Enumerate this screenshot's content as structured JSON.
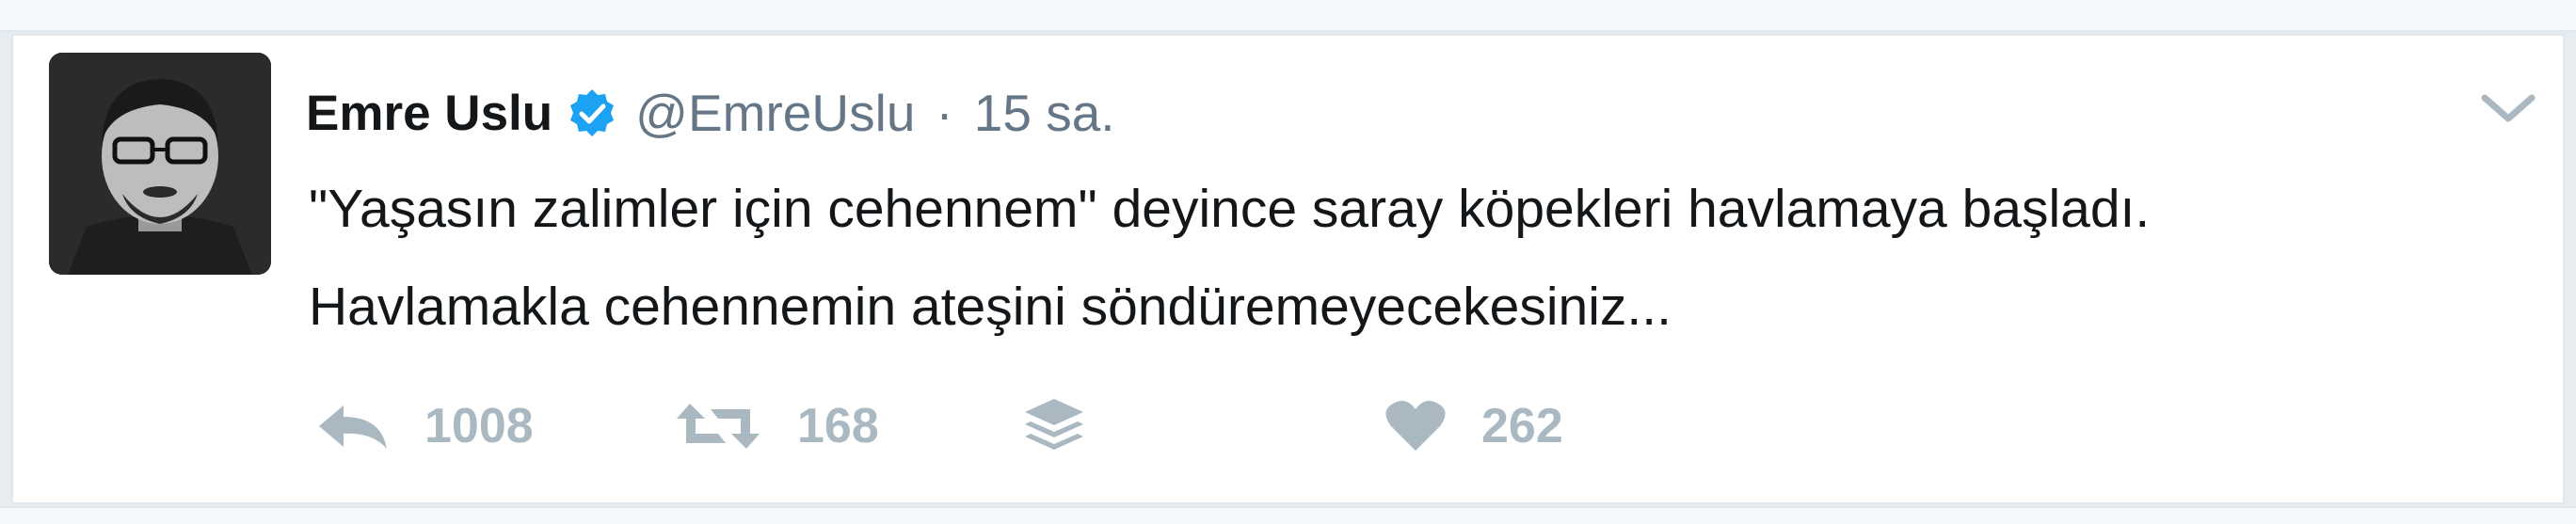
{
  "tweet": {
    "author_name": "Emre Uslu",
    "handle": "@EmreUslu",
    "separator": "·",
    "timestamp": "15 sa.",
    "verified_icon": "verified-badge-icon",
    "avatar_icon": "profile-photo",
    "menu_icon": "chevron-down-icon",
    "text_lines": [
      "\"Yaşasın zalimler için cehennem\" deyince saray köpekleri havlamaya başladı.",
      "Havlamakla cehennemin ateşini söndüremeyecekesiniz..."
    ]
  },
  "actions": {
    "reply": {
      "icon": "reply-icon",
      "count": "1008"
    },
    "retweet": {
      "icon": "retweet-icon",
      "count": "168"
    },
    "buffer": {
      "icon": "layers-icon"
    },
    "like": {
      "icon": "heart-icon",
      "count": "262"
    }
  },
  "colors": {
    "accent": "#1da1f2",
    "text": "#14171a",
    "muted": "#657786",
    "action_gray": "#aab8c2",
    "background": "#e6ecf0"
  }
}
